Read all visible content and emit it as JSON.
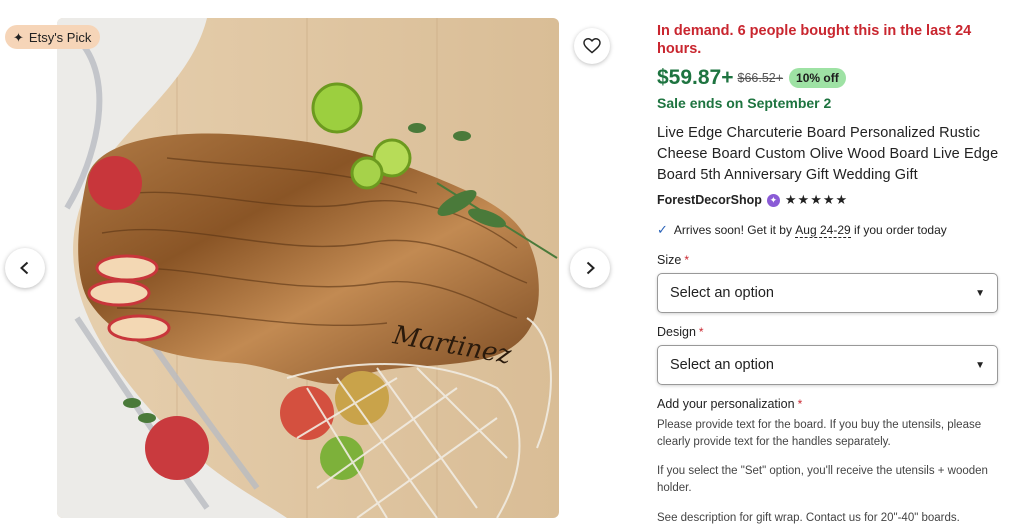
{
  "badge": {
    "icon": "sparkle-icon",
    "label": "Etsy's Pick"
  },
  "gallery": {
    "favorite_icon": "heart-icon",
    "prev_icon": "chevron-left-icon",
    "next_icon": "chevron-right-icon",
    "engraving": "Martinez"
  },
  "product": {
    "demand": "In demand. 6 people bought this in the last 24 hours.",
    "price": "$59.87+",
    "original_price": "$66.52+",
    "discount": "10% off",
    "sale_ends": "Sale ends on September 2",
    "title": "Live Edge Charcuterie Board Personalized Rustic Cheese Board Custom Olive Wood Board Live Edge Board 5th Anniversary Gift Wedding Gift",
    "shop_name": "ForestDecorShop",
    "rating_stars": "★★★★★",
    "colors": {
      "sale": "#1e7440",
      "demand": "#c9262f",
      "discount_bg": "#9ee2a4",
      "badge_bg": "#f6d5b8"
    }
  },
  "delivery": {
    "prefix": "Arrives soon! Get it by",
    "dates": "Aug 24-29",
    "suffix": "if you order today"
  },
  "options": {
    "size_label": "Size",
    "size_value": "Select an option",
    "design_label": "Design",
    "design_value": "Select an option",
    "required_mark": "*"
  },
  "personalization": {
    "label": "Add your personalization",
    "text1": "Please provide text for the board. If you buy the utensils, please clearly provide text for the handles separately.",
    "text2": "If you select the \"Set\" option, you'll receive the utensils + wooden holder.",
    "text3": "See description for gift wrap. Contact us for 20\"-40\" boards."
  }
}
